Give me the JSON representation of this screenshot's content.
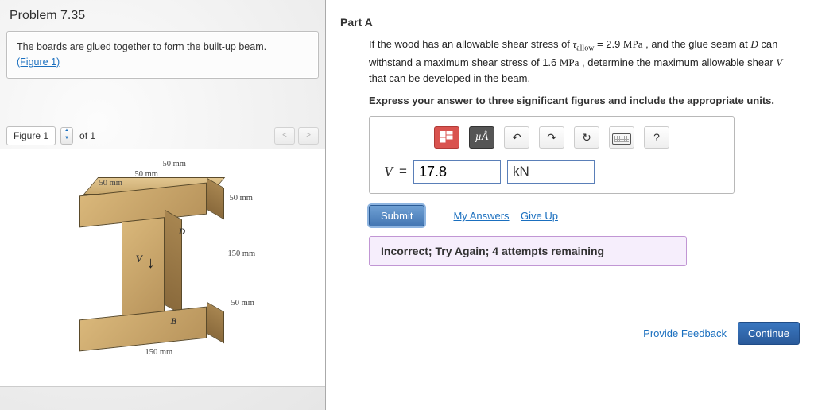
{
  "problem": {
    "title": "Problem 7.35",
    "statement": "The boards are glued together to form the built-up beam.",
    "figure_link": "(Figure 1)"
  },
  "figure": {
    "label": "Figure 1",
    "of": "of 1",
    "dims": {
      "a": "50 mm",
      "b": "50 mm",
      "c": "50 mm",
      "d": "50 mm",
      "e": "150 mm",
      "f": "50 mm",
      "g": "150 mm"
    },
    "labels": {
      "D": "D",
      "V": "V",
      "B": "B"
    }
  },
  "part": {
    "title": "Part A",
    "prompt_pre": "If the wood has an allowable shear stress of ",
    "tau": "τ",
    "tausub": "allow",
    "eq1": " = 2.9 ",
    "unit1": "MPa",
    "mid1": " , and the glue seam at ",
    "D": "D",
    "mid2": " can withstand a maximum shear stress of 1.6 ",
    "unit2": "MPa",
    "mid3": " , determine the maximum allowable shear ",
    "V": "V",
    "end": " that can be developed in the beam.",
    "instruction": "Express your answer to three significant figures and include the appropriate units."
  },
  "toolbar": {
    "ua_label": "µÅ",
    "help": "?"
  },
  "answer": {
    "var": "V",
    "eq": " = ",
    "value": "17.8",
    "unit": "kN"
  },
  "actions": {
    "submit": "Submit",
    "my_answers": "My Answers",
    "give_up": "Give Up",
    "feedback": "Incorrect; Try Again; 4 attempts remaining",
    "provide_feedback": "Provide Feedback",
    "continue": "Continue"
  }
}
